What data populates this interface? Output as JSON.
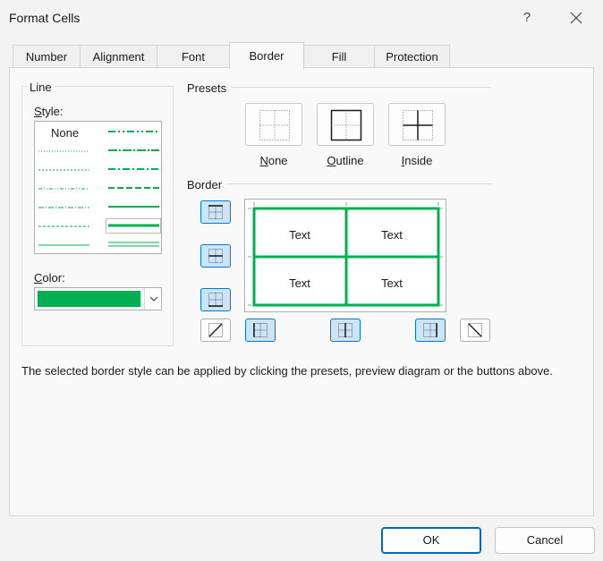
{
  "window": {
    "title": "Format Cells",
    "help": "?"
  },
  "tabs": [
    "Number",
    "Alignment",
    "Font",
    "Border",
    "Fill",
    "Protection"
  ],
  "active_tab": "Border",
  "line": {
    "group_label": "Line",
    "style_label_first": "S",
    "style_label_rest": "tyle:",
    "style_none": "None",
    "color_label_first": "C",
    "color_label_rest": "olor:",
    "color_value": "#00b050"
  },
  "presets": {
    "label": "Presets",
    "items": [
      {
        "first": "N",
        "rest": "one"
      },
      {
        "first": "O",
        "rest": "utline"
      },
      {
        "first": "I",
        "rest": "nside"
      }
    ]
  },
  "border": {
    "label": "Border",
    "preview_texts": [
      "Text",
      "Text",
      "Text",
      "Text"
    ],
    "line_color": "#00b050"
  },
  "description": "The selected border style can be applied by clicking the presets, preview diagram or the buttons above.",
  "buttons": {
    "ok": "OK",
    "cancel": "Cancel"
  }
}
